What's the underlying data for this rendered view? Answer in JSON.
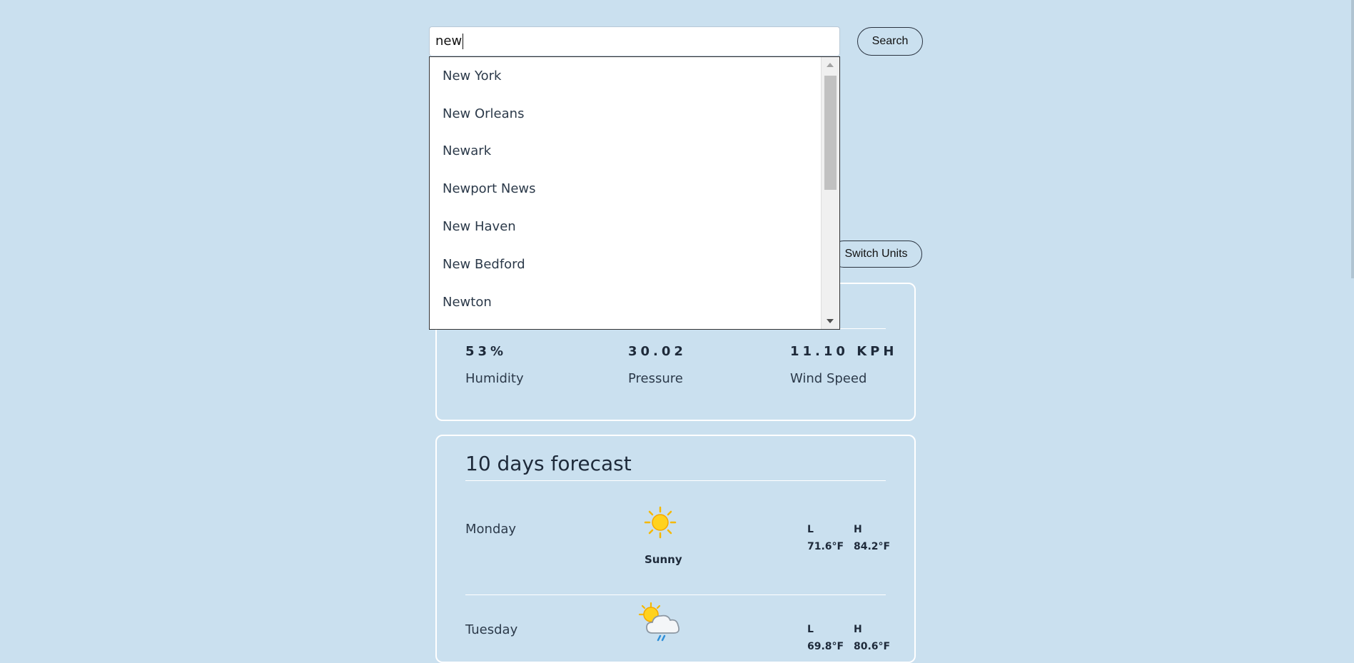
{
  "search": {
    "value": "new",
    "button_label": "Search"
  },
  "suggestions": [
    "New York",
    "New Orleans",
    "Newark",
    "Newport News",
    "New Haven",
    "New Bedford",
    "Newton"
  ],
  "switch_units_label": "Switch Units",
  "current": {
    "humidity": {
      "value": "53%",
      "label": "Humidity"
    },
    "pressure": {
      "value": "30.02",
      "label": "Pressure"
    },
    "wind": {
      "value": "11.10 KPH",
      "label": "Wind Speed"
    }
  },
  "forecast": {
    "title": "10 days forecast",
    "days": [
      {
        "day": "Monday",
        "condition": "Sunny",
        "icon": "sun-icon",
        "low_label": "L",
        "high_label": "H",
        "low": "71.6°F",
        "high": "84.2°F"
      },
      {
        "day": "Tuesday",
        "condition": "",
        "icon": "partly-cloudy-rain-icon",
        "low_label": "L",
        "high_label": "H",
        "low": "69.8°F",
        "high": "80.6°F"
      }
    ]
  },
  "colors": {
    "background": "#cae0ef",
    "card_border": "#ffffff",
    "text": "#1e2a3a",
    "sun": "#f5b800"
  }
}
